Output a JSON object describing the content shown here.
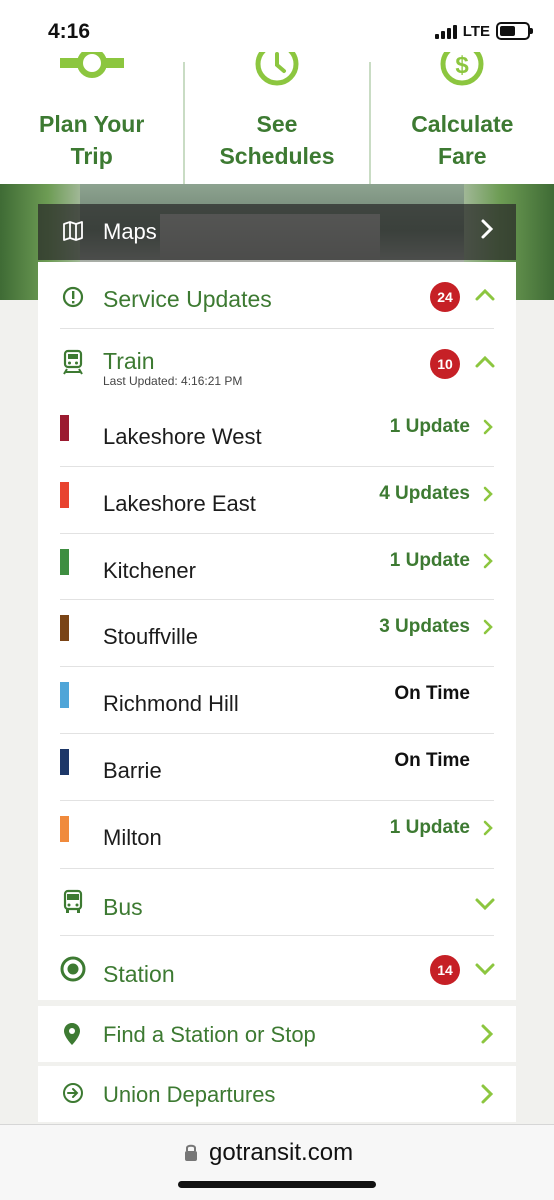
{
  "status_bar": {
    "time": "4:16",
    "network": "LTE",
    "battery_level": 0.58
  },
  "top_actions": [
    {
      "line1": "Plan Your",
      "line2": "Trip",
      "icon": "route-icon"
    },
    {
      "line1": "See",
      "line2": "Schedules",
      "icon": "clock-icon"
    },
    {
      "line1": "Calculate",
      "line2": "Fare",
      "icon": "dollar-icon"
    }
  ],
  "maps": {
    "label": "Maps",
    "icon": "map-icon"
  },
  "service_updates": {
    "title": "Service Updates",
    "count": "24"
  },
  "train": {
    "title": "Train",
    "count": "10",
    "last_updated": "Last Updated: 4:16:21 PM"
  },
  "lines": [
    {
      "name": "Lakeshore West",
      "status": "1 Update",
      "color": "#9b1b30",
      "has_updates": true
    },
    {
      "name": "Lakeshore East",
      "status": "4 Updates",
      "color": "#e8432f",
      "has_updates": true
    },
    {
      "name": "Kitchener",
      "status": "1 Update",
      "color": "#3e8e41",
      "has_updates": true
    },
    {
      "name": "Stouffville",
      "status": "3 Updates",
      "color": "#7a4416",
      "has_updates": true
    },
    {
      "name": "Richmond Hill",
      "status": "On Time",
      "color": "#4fa5d8",
      "has_updates": false
    },
    {
      "name": "Barrie",
      "status": "On Time",
      "color": "#1d3768",
      "has_updates": false
    },
    {
      "name": "Milton",
      "status": "1 Update",
      "color": "#f08a3c",
      "has_updates": true
    }
  ],
  "bus": {
    "title": "Bus"
  },
  "station": {
    "title": "Station",
    "count": "14"
  },
  "find_station": {
    "label": "Find a Station or Stop"
  },
  "union_departures": {
    "label": "Union Departures"
  },
  "browser": {
    "url": "gotransit.com"
  },
  "colors": {
    "brand_green": "#3d7a32",
    "badge_red": "#c62026",
    "chevron_green": "#8cc63f"
  }
}
